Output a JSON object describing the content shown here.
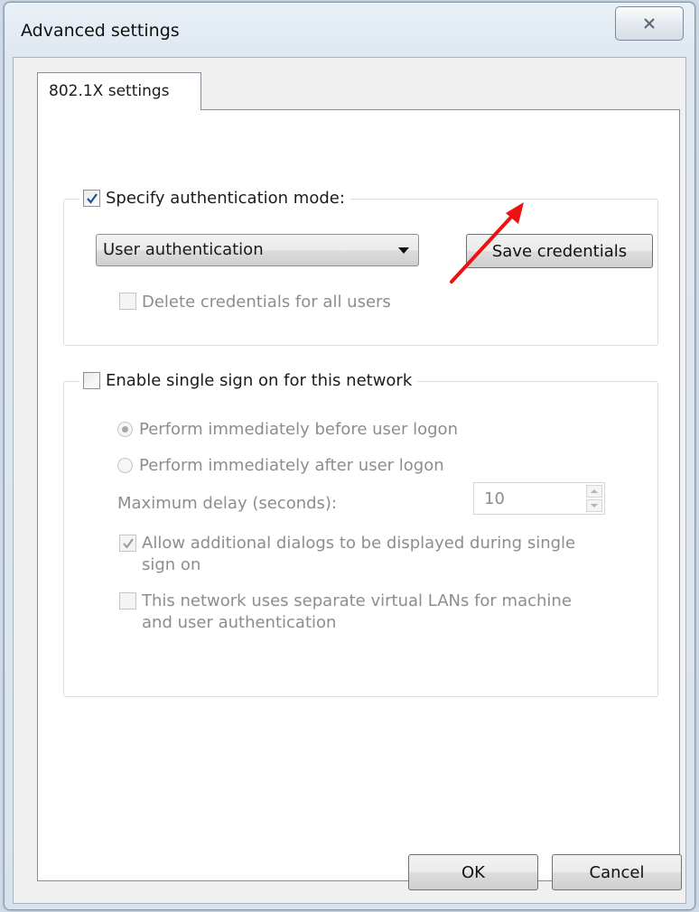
{
  "window": {
    "title": "Advanced settings",
    "close_glyph": "✕"
  },
  "tab": {
    "label": "802.1X settings"
  },
  "auth_group": {
    "checkbox_label": "Specify authentication mode:",
    "checkbox_checked": true,
    "mode_select_value": "User authentication",
    "save_button_label": "Save credentials",
    "delete_checkbox_label": "Delete credentials for all users",
    "delete_checkbox_checked": false
  },
  "sso_group": {
    "checkbox_label": "Enable single sign on for this network",
    "checkbox_checked": false,
    "radio_before_label": "Perform immediately before user logon",
    "radio_before_selected": true,
    "radio_after_label": "Perform immediately after user logon",
    "radio_after_selected": false,
    "max_delay_label": "Maximum delay (seconds):",
    "max_delay_value": "10",
    "allow_dialogs_label_line1": "Allow additional dialogs to be displayed during single",
    "allow_dialogs_label_line2": "sign on",
    "allow_dialogs_checked": true,
    "separate_vlan_label_line1": "This network uses separate virtual LANs for machine",
    "separate_vlan_label_line2": "and user authentication",
    "separate_vlan_checked": false
  },
  "footer": {
    "ok_label": "OK",
    "cancel_label": "Cancel"
  },
  "icons": {
    "check": "checkmark-icon",
    "close": "close-icon",
    "annotation": "red-arrow-annotation"
  },
  "colors": {
    "annotation_arrow": "#ee1111",
    "check_enabled": "#1f4e9c",
    "check_disabled": "#9a9a9a"
  }
}
